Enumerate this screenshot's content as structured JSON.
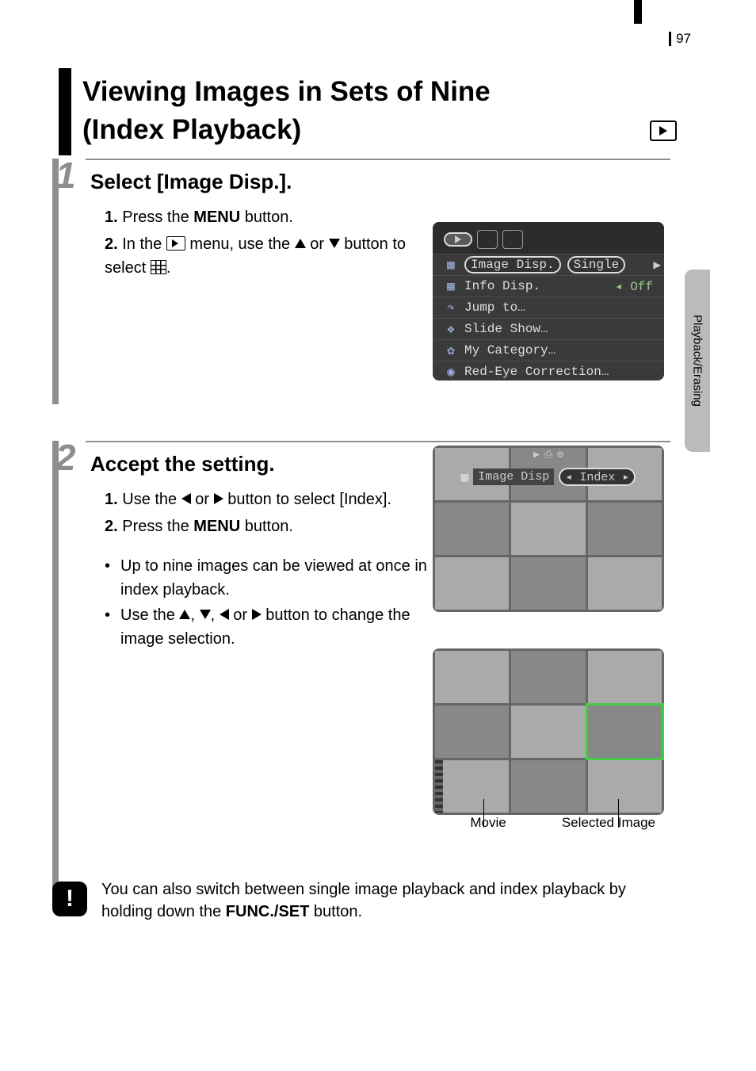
{
  "page_number": "97",
  "side_tab": "Playback/Erasing",
  "heading": {
    "line1": "Viewing Images in Sets of Nine",
    "line2": "(Index Playback)"
  },
  "steps": {
    "one": {
      "number": "1",
      "title": "Select [Image Disp.].",
      "sub1_pre": "1.",
      "sub1_text_a": "Press the ",
      "sub1_bold": "MENU",
      "sub1_text_b": " button.",
      "sub2_pre": "2.",
      "sub2_text_a": "In the ",
      "sub2_text_b": " menu, use the ",
      "sub2_text_c": " or ",
      "sub2_text_d": " button to select ",
      "sub2_text_e": "."
    },
    "two": {
      "number": "2",
      "title": "Accept the setting.",
      "sub1_pre": "1.",
      "sub1_text_a": "Use the ",
      "sub1_text_b": " or ",
      "sub1_text_c": " button to select [Index].",
      "sub2_pre": "2.",
      "sub2_text_a": "Press the ",
      "sub2_bold": "MENU",
      "sub2_text_b": " button."
    }
  },
  "bullets": {
    "b1": "Up to nine images can be viewed at once in index playback.",
    "b2_a": "Use the ",
    "b2_b": ", ",
    "b2_c": ", ",
    "b2_d": " or ",
    "b2_e": " button to change the image selection."
  },
  "screenshot1_menu": {
    "item1": "Image Disp.",
    "item1_val": "Single",
    "item2": "Info Disp.",
    "item2_val": "Off",
    "item3": "Jump to…",
    "item4": "Slide Show…",
    "item5": "My Category…",
    "item6": "Red-Eye Correction…"
  },
  "screenshot2": {
    "label": "Image Disp",
    "value": "Index"
  },
  "callouts": {
    "left": "Movie",
    "right": "Selected Image"
  },
  "note": {
    "text_a": "You can also switch between single image playback and index playback by holding down the ",
    "bold": "FUNC./SET",
    "text_b": " button."
  }
}
